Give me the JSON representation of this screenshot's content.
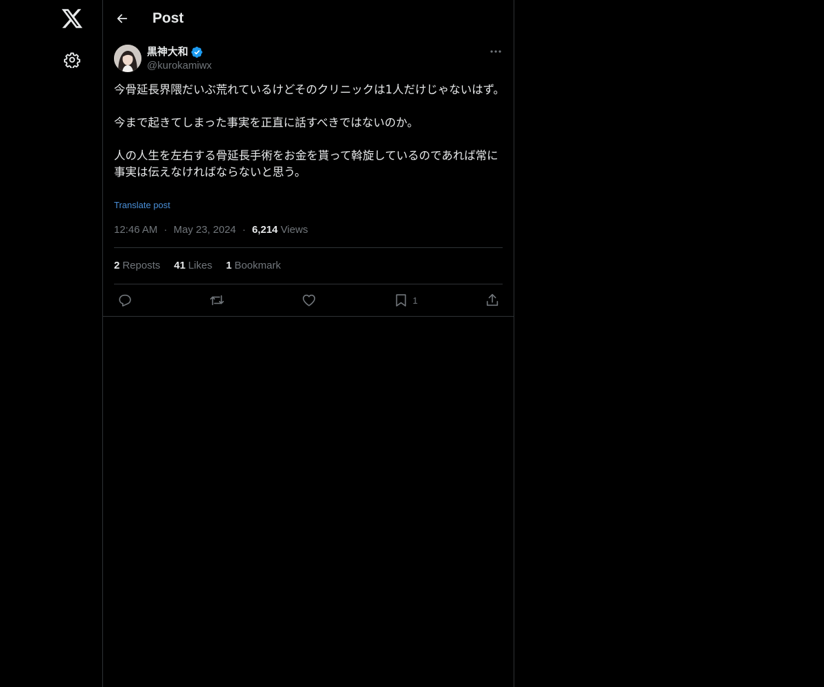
{
  "nav": {
    "logo_icon": "x-logo-icon",
    "settings_icon": "gear-icon"
  },
  "header": {
    "back_icon": "arrow-left-icon",
    "title": "Post"
  },
  "post": {
    "author": {
      "name": "黒神大和",
      "handle": "@kurokamiwx",
      "verified": true
    },
    "paragraphs": [
      "今骨延長界隈だいぶ荒れているけどそのクリニックは1人だけじゃないはず。",
      "今まで起きてしまった事実を正直に話すべきではないのか。",
      "人の人生を左右する骨延長手術をお金を貰って斡旋しているのであれば常に事実は伝えなければならないと思う。"
    ],
    "translate_label": "Translate post",
    "time": "12:46 AM",
    "separator": "·",
    "date": "May 23, 2024",
    "views_count": "6,214",
    "views_label": "Views",
    "stats": {
      "reposts_count": "2",
      "reposts_label": "Reposts",
      "likes_count": "41",
      "likes_label": "Likes",
      "bookmarks_count": "1",
      "bookmarks_label": "Bookmark"
    },
    "actions": {
      "reply_icon": "reply-icon",
      "repost_icon": "repost-icon",
      "like_icon": "heart-icon",
      "bookmark_icon": "bookmark-icon",
      "bookmark_count": "1",
      "share_icon": "share-icon"
    }
  },
  "colors": {
    "background": "#000000",
    "text_primary": "#e7e9ea",
    "text_secondary": "#71767b",
    "link": "#4a90d9",
    "verified": "#1d9bf0",
    "border": "#2f3336"
  }
}
